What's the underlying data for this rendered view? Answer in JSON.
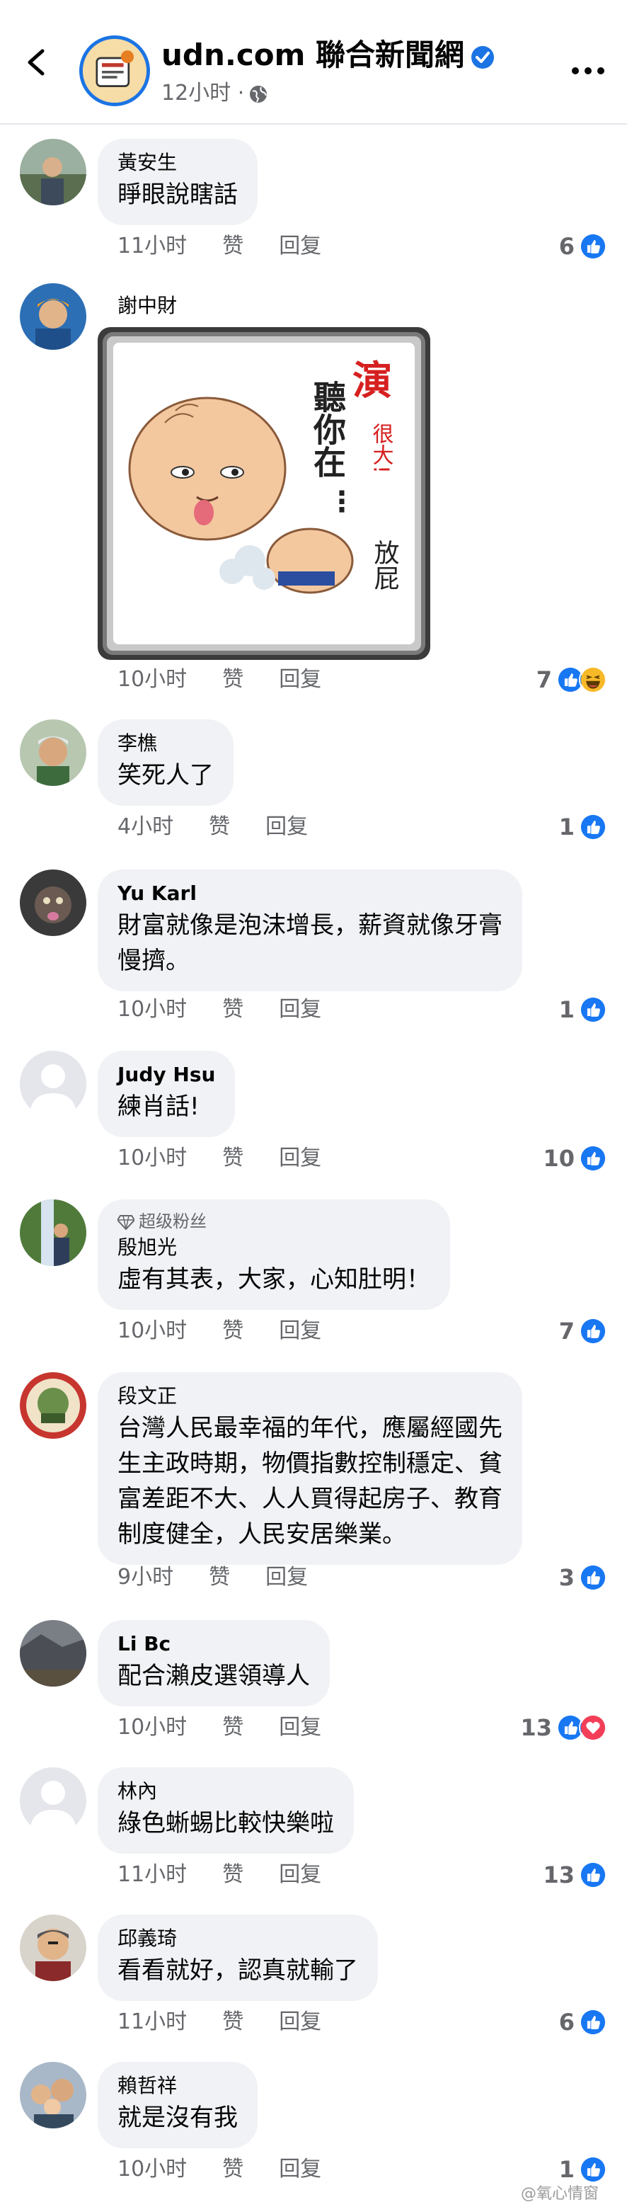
{
  "header": {
    "title": "udn.com 聯合新聞網",
    "subtitle": "12小时 ·",
    "colors": {
      "verified": "#1b74e4",
      "meta": "#65676b"
    }
  },
  "comments": [
    {
      "name": "黃安生",
      "text": [
        "睜眼說瞎話"
      ],
      "time": "11小时",
      "like": "赞",
      "reply": "回复",
      "count": "6"
    },
    {
      "name": "謝中財",
      "time": "10小时",
      "like": "赞",
      "reply": "回复",
      "count": "7"
    },
    {
      "name": "李樵",
      "text": [
        "笑死人了"
      ],
      "time": "4小时",
      "like": "赞",
      "reply": "回复",
      "count": "1"
    },
    {
      "name": "Yu  Karl",
      "text": [
        "財富就像是泡沫增長，薪資就像牙膏",
        "慢擠。"
      ],
      "time": "10小时",
      "like": "赞",
      "reply": "回复",
      "count": "1"
    },
    {
      "name": "Judy Hsu",
      "text": [
        "練肖話!"
      ],
      "time": "10小时",
      "like": "赞",
      "reply": "回复",
      "count": "10"
    },
    {
      "badge": "超级粉丝",
      "name": "殷旭光",
      "text": [
        "虛有其表，大家，心知肚明！"
      ],
      "time": "10小时",
      "like": "赞",
      "reply": "回复",
      "count": "7"
    },
    {
      "name": "段文正",
      "text": [
        "台灣人民最幸福的年代，應屬經國先",
        "生主政時期，物價指數控制穩定、貧",
        "富差距不大、人人買得起房子、教育",
        "制度健全，人民安居樂業。"
      ],
      "time": "9小时",
      "like": "赞",
      "reply": "回复",
      "count": "3"
    },
    {
      "name": "Li Bc",
      "text": [
        "配合瀨皮選領導人"
      ],
      "time": "10小时",
      "like": "赞",
      "reply": "回复",
      "count": "13"
    },
    {
      "name": "林內",
      "text": [
        "綠色蜥蜴比較快樂啦"
      ],
      "time": "11小时",
      "like": "赞",
      "reply": "回复",
      "count": "13"
    },
    {
      "name": "邱義琦",
      "text": [
        "看看就好，認真就輸了"
      ],
      "time": "11小时",
      "like": "赞",
      "reply": "回复",
      "count": "6"
    },
    {
      "name": "賴哲祥",
      "text": [
        "就是沒有我"
      ],
      "time": "10小时",
      "like": "赞",
      "reply": "回复",
      "count": "1"
    }
  ],
  "sticker": {
    "big": "演",
    "small": "很大!",
    "side": "聽你在",
    "end": "放屁"
  },
  "watermark": "@氧心情窗"
}
